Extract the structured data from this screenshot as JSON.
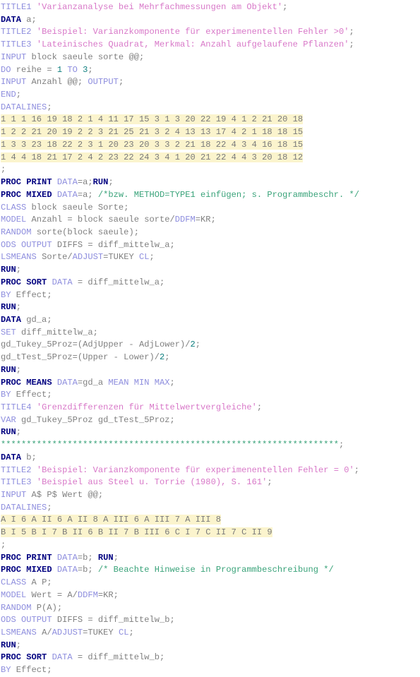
{
  "document": {
    "language": "SAS",
    "title": "SAS program listing",
    "colors": {
      "background": "#ffffff",
      "keyword": "#000080",
      "statement": "#8e8ede",
      "string": "#d878c8",
      "number": "#108080",
      "comment": "#3aa37a",
      "plain": "#808080",
      "datalines_highlight": "#fbf4cd"
    }
  },
  "code": {
    "lines": [
      {
        "n": 1,
        "text": "TITLE1 'Varianzanalyse bei Mehrfachmessungen am Objekt';"
      },
      {
        "n": 2,
        "text": "DATA a;"
      },
      {
        "n": 3,
        "text": "TITLE2 'Beispiel: Varianzkomponente für experimenentellen Fehler >0';"
      },
      {
        "n": 4,
        "text": "TITLE3 'Lateinisches Quadrat, Merkmal: Anzahl aufgelaufene Pflanzen';"
      },
      {
        "n": 5,
        "text": "INPUT block saeule sorte @@;"
      },
      {
        "n": 6,
        "text": "DO reihe = 1 TO 3;"
      },
      {
        "n": 7,
        "text": "INPUT Anzahl @@; OUTPUT;"
      },
      {
        "n": 8,
        "text": "END;"
      },
      {
        "n": 9,
        "text": "DATALINES;"
      },
      {
        "n": 10,
        "text": "1 1 1 16 19 18 2 1 4 11 17 15 3 1 3 20 22 19 4 1 2 21 20 18"
      },
      {
        "n": 11,
        "text": "1 2 2 21 20 19 2 2 3 21 25 21 3 2 4 13 13 17 4 2 1 18 18 15"
      },
      {
        "n": 12,
        "text": "1 3 3 23 18 22 2 3 1 20 23 20 3 3 2 21 18 22 4 3 4 16 18 15"
      },
      {
        "n": 13,
        "text": "1 4 4 18 21 17 2 4 2 23 22 24 3 4 1 20 21 22 4 4 3 20 18 12"
      },
      {
        "n": 14,
        "text": ";"
      },
      {
        "n": 15,
        "text": "PROC PRINT DATA=a;RUN;"
      },
      {
        "n": 16,
        "text": "PROC MIXED DATA=a; /*bzw. METHOD=TYPE1 einfügen; s. Programmbeschr. */"
      },
      {
        "n": 17,
        "text": "CLASS block saeule Sorte;"
      },
      {
        "n": 18,
        "text": "MODEL Anzahl = block saeule sorte/DDFM=KR;"
      },
      {
        "n": 19,
        "text": "RANDOM sorte(block saeule);"
      },
      {
        "n": 20,
        "text": "ODS OUTPUT DIFFS = diff_mittelw_a;"
      },
      {
        "n": 21,
        "text": "LSMEANS Sorte/ADJUST=TUKEY CL;"
      },
      {
        "n": 22,
        "text": "RUN;"
      },
      {
        "n": 23,
        "text": "PROC SORT DATA = diff_mittelw_a;"
      },
      {
        "n": 24,
        "text": "BY Effect;"
      },
      {
        "n": 25,
        "text": "RUN;"
      },
      {
        "n": 26,
        "text": "DATA gd_a;"
      },
      {
        "n": 27,
        "text": "SET diff_mittelw_a;"
      },
      {
        "n": 28,
        "text": "gd_Tukey_5Proz=(AdjUpper - AdjLower)/2;"
      },
      {
        "n": 29,
        "text": "gd_tTest_5Proz=(Upper - Lower)/2;"
      },
      {
        "n": 30,
        "text": "RUN;"
      },
      {
        "n": 31,
        "text": "PROC MEANS DATA=gd_a MEAN MIN MAX;"
      },
      {
        "n": 32,
        "text": "BY Effect;"
      },
      {
        "n": 33,
        "text": "TITLE4 'Grenzdifferenzen für Mittelwertvergleiche';"
      },
      {
        "n": 34,
        "text": "VAR gd_Tukey_5Proz gd_tTest_5Proz;"
      },
      {
        "n": 35,
        "text": "RUN;"
      },
      {
        "n": 36,
        "text": "******************************************************************;"
      },
      {
        "n": 37,
        "text": "DATA b;"
      },
      {
        "n": 38,
        "text": "TITLE2 'Beispiel: Varianzkomponente für experimenentellen Fehler = 0';"
      },
      {
        "n": 39,
        "text": "TITLE3 'Beispiel aus Steel u. Torrie (1980), S. 161';"
      },
      {
        "n": 40,
        "text": "INPUT A$ P$ Wert @@;"
      },
      {
        "n": 41,
        "text": "DATALINES;"
      },
      {
        "n": 42,
        "text": "A I 6 A II 6 A II 8 A III 6 A III 7 A III 8"
      },
      {
        "n": 43,
        "text": "B I 5 B I 7 B II 6 B II 7 B III 6 C I 7 C II 7 C II 9"
      },
      {
        "n": 44,
        "text": ";"
      },
      {
        "n": 45,
        "text": "PROC PRINT DATA=b; RUN;"
      },
      {
        "n": 46,
        "text": "PROC MIXED DATA=b; /* Beachte Hinweise in Programmbeschreibung */"
      },
      {
        "n": 47,
        "text": "CLASS A P;"
      },
      {
        "n": 48,
        "text": "MODEL Wert = A/DDFM=KR;"
      },
      {
        "n": 49,
        "text": "RANDOM P(A);"
      },
      {
        "n": 50,
        "text": "ODS OUTPUT DIFFS = diff_mittelw_b;"
      },
      {
        "n": 51,
        "text": "LSMEANS A/ADJUST=TUKEY CL;"
      },
      {
        "n": 52,
        "text": "RUN;"
      },
      {
        "n": 53,
        "text": "PROC SORT DATA = diff_mittelw_b;"
      },
      {
        "n": 54,
        "text": "BY Effect;"
      }
    ],
    "tokens": {
      "l1": [
        [
          "stmt",
          "TITLE1"
        ],
        [
          "plain",
          " "
        ],
        [
          "str",
          "'Varianzanalyse bei Mehrfachmessungen am Objekt'"
        ],
        [
          "plain",
          ";"
        ]
      ],
      "l2": [
        [
          "kw",
          "DATA"
        ],
        [
          "plain",
          " a;"
        ]
      ],
      "l3": [
        [
          "stmt",
          "TITLE2"
        ],
        [
          "plain",
          " "
        ],
        [
          "str",
          "'Beispiel: Varianzkomponente für experimenentellen Fehler >0'"
        ],
        [
          "plain",
          ";"
        ]
      ],
      "l4": [
        [
          "stmt",
          "TITLE3"
        ],
        [
          "plain",
          " "
        ],
        [
          "str",
          "'Lateinisches Quadrat, Merkmal: Anzahl aufgelaufene Pflanzen'"
        ],
        [
          "plain",
          ";"
        ]
      ],
      "l5": [
        [
          "stmt",
          "INPUT"
        ],
        [
          "plain",
          " block saeule sorte @@;"
        ]
      ],
      "l6": [
        [
          "stmt",
          "DO"
        ],
        [
          "plain",
          " reihe = "
        ],
        [
          "num",
          "1"
        ],
        [
          "plain",
          " "
        ],
        [
          "stmt",
          "TO"
        ],
        [
          "plain",
          " "
        ],
        [
          "num",
          "3"
        ],
        [
          "plain",
          ";"
        ]
      ],
      "l7": [
        [
          "stmt",
          "INPUT"
        ],
        [
          "plain",
          " Anzahl @@; "
        ],
        [
          "stmt",
          "OUTPUT"
        ],
        [
          "plain",
          ";"
        ]
      ],
      "l8": [
        [
          "stmt",
          "END"
        ],
        [
          "plain",
          ";"
        ]
      ],
      "l9": [
        [
          "stmt",
          "DATALINES"
        ],
        [
          "plain",
          ";"
        ]
      ],
      "l14": [
        [
          "plain",
          ";"
        ]
      ],
      "l15": [
        [
          "kw",
          "PROC PRINT"
        ],
        [
          "plain",
          " "
        ],
        [
          "stmt",
          "DATA"
        ],
        [
          "plain",
          "=a;"
        ],
        [
          "kw",
          "RUN"
        ],
        [
          "plain",
          ";"
        ]
      ],
      "l16": [
        [
          "kw",
          "PROC MIXED"
        ],
        [
          "plain",
          " "
        ],
        [
          "stmt",
          "DATA"
        ],
        [
          "plain",
          "=a; "
        ],
        [
          "cmt",
          "/*bzw. METHOD=TYPE1 einfügen; s. Programmbeschr. */"
        ]
      ],
      "l17": [
        [
          "stmt",
          "CLASS"
        ],
        [
          "plain",
          " block saeule Sorte;"
        ]
      ],
      "l18": [
        [
          "stmt",
          "MODEL"
        ],
        [
          "plain",
          " Anzahl = block saeule sorte/"
        ],
        [
          "opt",
          "DDFM"
        ],
        [
          "plain",
          "=KR;"
        ]
      ],
      "l19": [
        [
          "stmt",
          "RANDOM"
        ],
        [
          "plain",
          " sorte(block saeule);"
        ]
      ],
      "l20": [
        [
          "stmt",
          "ODS OUTPUT"
        ],
        [
          "plain",
          " DIFFS = diff_mittelw_a;"
        ]
      ],
      "l21": [
        [
          "stmt",
          "LSMEANS"
        ],
        [
          "plain",
          " Sorte/"
        ],
        [
          "opt",
          "ADJUST"
        ],
        [
          "plain",
          "=TUKEY "
        ],
        [
          "opt",
          "CL"
        ],
        [
          "plain",
          ";"
        ]
      ],
      "l22": [
        [
          "kw",
          "RUN"
        ],
        [
          "plain",
          ";"
        ]
      ],
      "l23": [
        [
          "kw",
          "PROC SORT"
        ],
        [
          "plain",
          " "
        ],
        [
          "stmt",
          "DATA"
        ],
        [
          "plain",
          " = diff_mittelw_a;"
        ]
      ],
      "l24": [
        [
          "stmt",
          "BY"
        ],
        [
          "plain",
          " Effect;"
        ]
      ],
      "l25": [
        [
          "kw",
          "RUN"
        ],
        [
          "plain",
          ";"
        ]
      ],
      "l26": [
        [
          "kw",
          "DATA"
        ],
        [
          "plain",
          " gd_a;"
        ]
      ],
      "l27": [
        [
          "stmt",
          "SET"
        ],
        [
          "plain",
          " diff_mittelw_a;"
        ]
      ],
      "l28": [
        [
          "plain",
          "gd_Tukey_5Proz=(AdjUpper - AdjLower)/"
        ],
        [
          "num",
          "2"
        ],
        [
          "plain",
          ";"
        ]
      ],
      "l29": [
        [
          "plain",
          "gd_tTest_5Proz=(Upper - Lower)/"
        ],
        [
          "num",
          "2"
        ],
        [
          "plain",
          ";"
        ]
      ],
      "l30": [
        [
          "kw",
          "RUN"
        ],
        [
          "plain",
          ";"
        ]
      ],
      "l31": [
        [
          "kw",
          "PROC MEANS"
        ],
        [
          "plain",
          " "
        ],
        [
          "stmt",
          "DATA"
        ],
        [
          "plain",
          "=gd_a "
        ],
        [
          "opt",
          "MEAN MIN MAX"
        ],
        [
          "plain",
          ";"
        ]
      ],
      "l32": [
        [
          "stmt",
          "BY"
        ],
        [
          "plain",
          " Effect;"
        ]
      ],
      "l33": [
        [
          "stmt",
          "TITLE4"
        ],
        [
          "plain",
          " "
        ],
        [
          "str",
          "'Grenzdifferenzen für Mittelwertvergleiche'"
        ],
        [
          "plain",
          ";"
        ]
      ],
      "l34": [
        [
          "stmt",
          "VAR"
        ],
        [
          "plain",
          " gd_Tukey_5Proz gd_tTest_5Proz;"
        ]
      ],
      "l35": [
        [
          "kw",
          "RUN"
        ],
        [
          "plain",
          ";"
        ]
      ],
      "l36": [
        [
          "star",
          "******************************************************************"
        ],
        [
          "plain",
          ";"
        ]
      ],
      "l37": [
        [
          "kw",
          "DATA"
        ],
        [
          "plain",
          " b;"
        ]
      ],
      "l38": [
        [
          "stmt",
          "TITLE2"
        ],
        [
          "plain",
          " "
        ],
        [
          "str",
          "'Beispiel: Varianzkomponente für experimenentellen Fehler = 0'"
        ],
        [
          "plain",
          ";"
        ]
      ],
      "l39": [
        [
          "stmt",
          "TITLE3"
        ],
        [
          "plain",
          " "
        ],
        [
          "str",
          "'Beispiel aus Steel u. Torrie (1980), S. 161'"
        ],
        [
          "plain",
          ";"
        ]
      ],
      "l40": [
        [
          "stmt",
          "INPUT"
        ],
        [
          "plain",
          " A$ P$ Wert @@;"
        ]
      ],
      "l41": [
        [
          "stmt",
          "DATALINES"
        ],
        [
          "plain",
          ";"
        ]
      ],
      "l44": [
        [
          "plain",
          ";"
        ]
      ],
      "l45": [
        [
          "kw",
          "PROC PRINT"
        ],
        [
          "plain",
          " "
        ],
        [
          "stmt",
          "DATA"
        ],
        [
          "plain",
          "=b; "
        ],
        [
          "kw",
          "RUN"
        ],
        [
          "plain",
          ";"
        ]
      ],
      "l46": [
        [
          "kw",
          "PROC MIXED"
        ],
        [
          "plain",
          " "
        ],
        [
          "stmt",
          "DATA"
        ],
        [
          "plain",
          "=b; "
        ],
        [
          "cmt",
          "/* Beachte Hinweise in Programmbeschreibung */"
        ]
      ],
      "l47": [
        [
          "stmt",
          "CLASS"
        ],
        [
          "plain",
          " A P;"
        ]
      ],
      "l48": [
        [
          "stmt",
          "MODEL"
        ],
        [
          "plain",
          " Wert = A/"
        ],
        [
          "opt",
          "DDFM"
        ],
        [
          "plain",
          "=KR;"
        ]
      ],
      "l49": [
        [
          "stmt",
          "RANDOM"
        ],
        [
          "plain",
          " P(A);"
        ]
      ],
      "l50": [
        [
          "stmt",
          "ODS OUTPUT"
        ],
        [
          "plain",
          " DIFFS = diff_mittelw_b;"
        ]
      ],
      "l51": [
        [
          "stmt",
          "LSMEANS"
        ],
        [
          "plain",
          " A/"
        ],
        [
          "opt",
          "ADJUST"
        ],
        [
          "plain",
          "=TUKEY "
        ],
        [
          "opt",
          "CL"
        ],
        [
          "plain",
          ";"
        ]
      ],
      "l52": [
        [
          "kw",
          "RUN"
        ],
        [
          "plain",
          ";"
        ]
      ],
      "l53": [
        [
          "kw",
          "PROC SORT"
        ],
        [
          "plain",
          " "
        ],
        [
          "stmt",
          "DATA"
        ],
        [
          "plain",
          " = diff_mittelw_b;"
        ]
      ],
      "l54": [
        [
          "stmt",
          "BY"
        ],
        [
          "plain",
          " Effect;"
        ]
      ]
    },
    "datalines_a": [
      "1 1 1 16 19 18 2 1 4 11 17 15 3 1 3 20 22 19 4 1 2 21 20 18",
      "1 2 2 21 20 19 2 2 3 21 25 21 3 2 4 13 13 17 4 2 1 18 18 15",
      "1 3 3 23 18 22 2 3 1 20 23 20 3 3 2 21 18 22 4 3 4 16 18 15",
      "1 4 4 18 21 17 2 4 2 23 22 24 3 4 1 20 21 22 4 4 3 20 18 12"
    ],
    "datalines_b": [
      "A I 6 A II 6 A II 8 A III 6 A III 7 A III 8",
      "B I 5 B I 7 B II 6 B II 7 B III 6 C I 7 C II 7 C II 9"
    ]
  }
}
